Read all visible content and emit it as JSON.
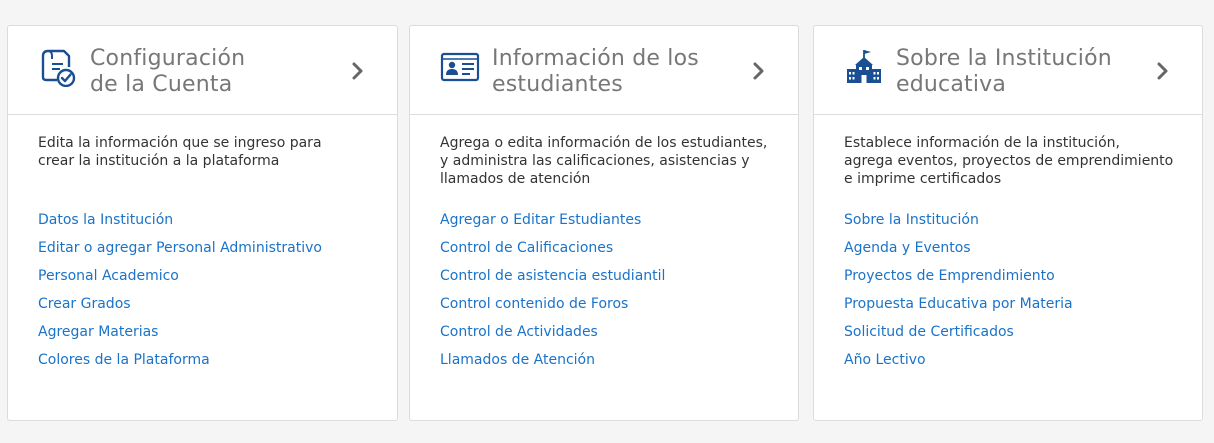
{
  "colors": {
    "background": "#f5f5f5",
    "card": "#ffffff",
    "title": "#777777",
    "icon": "#1a4f94",
    "link": "#1a73c9",
    "text": "#333333"
  },
  "cards": [
    {
      "icon": "document-check-icon",
      "title_line1": "Configuración",
      "title_line2": "de la Cuenta",
      "description_line1": "Edita la información que se ingreso para",
      "description_line2": "crear la institución a la plataforma",
      "description_line3": "",
      "links": [
        "Datos la Institución",
        "Editar o agregar Personal Administrativo",
        "Personal Academico",
        "Crear Grados",
        "Agregar Materias",
        "Colores de la Plataforma"
      ]
    },
    {
      "icon": "id-card-icon",
      "title_line1": "Información de los",
      "title_line2": "estudiantes",
      "description_line1": "Agrega o edita información de los estudiantes,",
      "description_line2": "y administra las calificaciones, asistencias y",
      "description_line3": "llamados de atención",
      "links": [
        "Agregar o Editar Estudiantes",
        "Control de Calificaciones",
        "Control de asistencia estudiantil",
        "Control contenido de Foros",
        "Control de Actividades",
        "Llamados de Atención"
      ]
    },
    {
      "icon": "school-building-icon",
      "title_line1": "Sobre la Institución",
      "title_line2": "educativa",
      "description_line1": "Establece información de la institución,",
      "description_line2": "agrega eventos, proyectos de emprendimiento",
      "description_line3": "e imprime certificados",
      "links": [
        "Sobre la Institución",
        "Agenda y Eventos",
        "Proyectos de Emprendimiento",
        "Propuesta Educativa por Materia",
        "Solicitud de Certificados",
        "Año Lectivo"
      ]
    }
  ]
}
